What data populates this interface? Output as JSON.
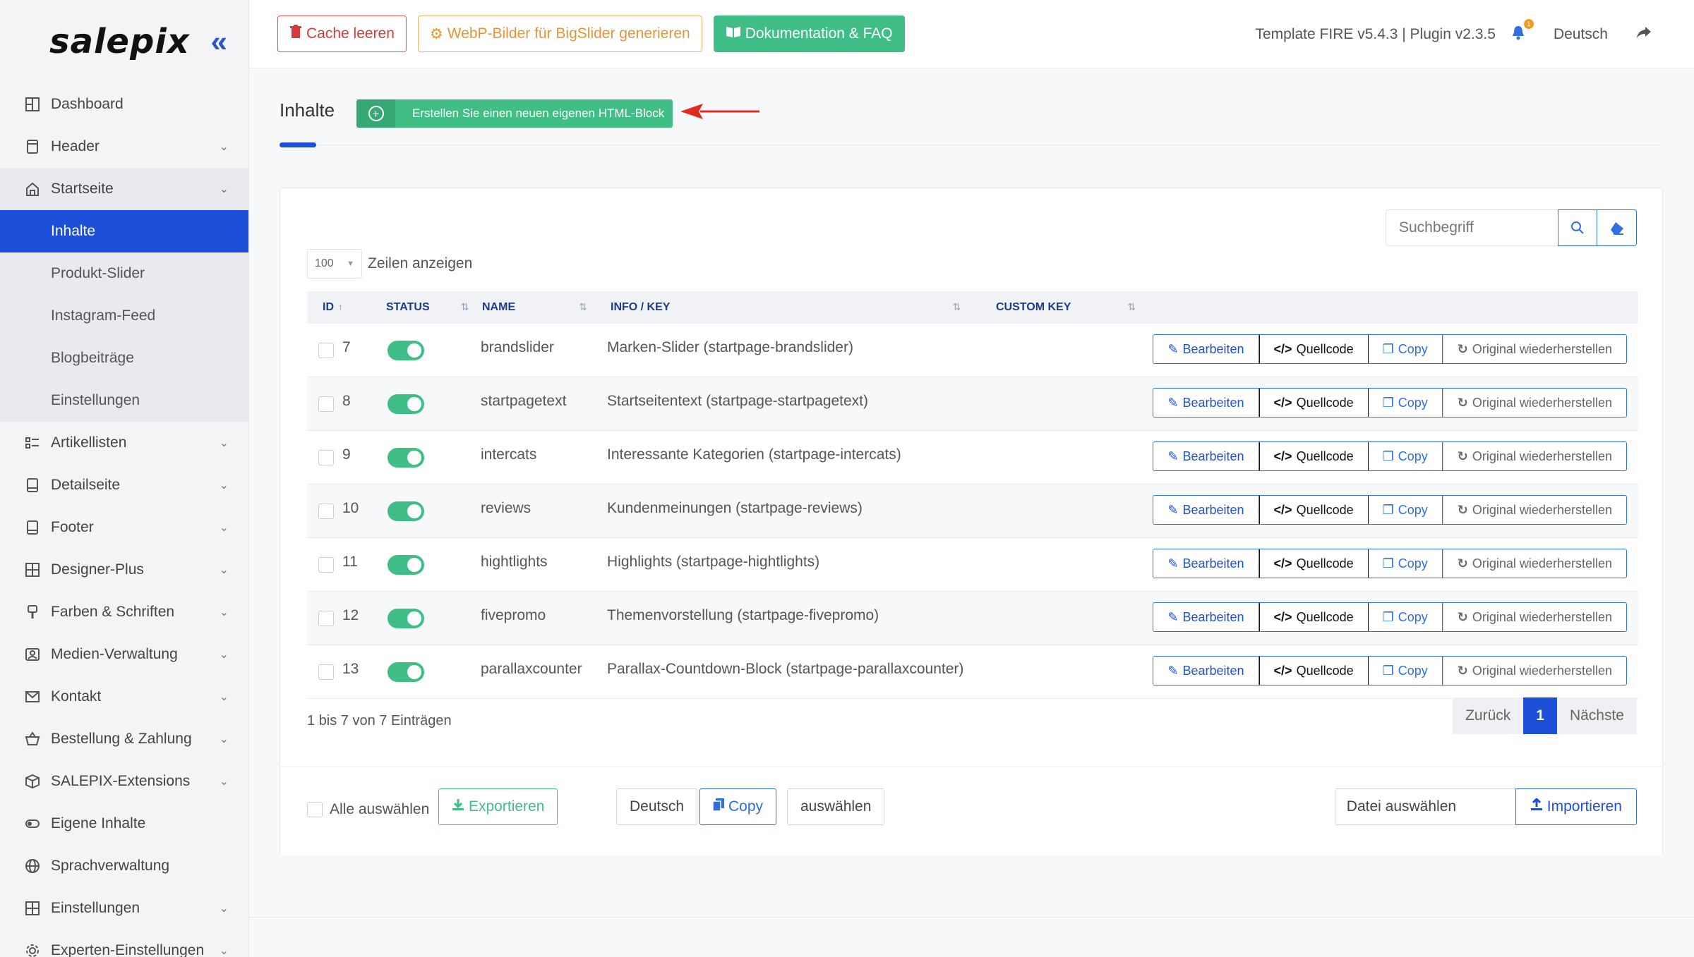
{
  "sidebar": {
    "logo": "salepix",
    "items": [
      {
        "label": "Dashboard",
        "icon": "dashboard-icon"
      },
      {
        "label": "Header",
        "icon": "header-icon"
      },
      {
        "label": "Startseite",
        "icon": "home-icon"
      },
      {
        "label": "Artikellisten",
        "icon": "list-icon"
      },
      {
        "label": "Detailseite",
        "icon": "page-icon"
      },
      {
        "label": "Footer",
        "icon": "page-icon"
      },
      {
        "label": "Designer-Plus",
        "icon": "grid-icon"
      },
      {
        "label": "Farben & Schriften",
        "icon": "paint-icon"
      },
      {
        "label": "Medien-Verwaltung",
        "icon": "image-icon"
      },
      {
        "label": "Kontakt",
        "icon": "mail-icon"
      },
      {
        "label": "Bestellung & Zahlung",
        "icon": "basket-icon"
      },
      {
        "label": "SALEPIX-Extensions",
        "icon": "cube-icon"
      },
      {
        "label": "Eigene Inhalte",
        "icon": "toggle-icon"
      },
      {
        "label": "Sprachverwaltung",
        "icon": "globe-icon"
      },
      {
        "label": "Einstellungen",
        "icon": "grid-icon"
      },
      {
        "label": "Experten-Einstellungen",
        "icon": "gear-icon"
      }
    ],
    "sub_items": [
      "Inhalte",
      "Produkt-Slider",
      "Instagram-Feed",
      "Blogbeiträge",
      "Einstellungen"
    ]
  },
  "topbar": {
    "cache_label": "Cache leeren",
    "webp_label": "WebP-Bilder für BigSlider generieren",
    "doc_label": "Dokumentation & FAQ",
    "version": "Template FIRE v5.4.3 | Plugin v2.3.5",
    "notifications": "1",
    "language": "Deutsch"
  },
  "page": {
    "title": "Inhalte",
    "create_label": "Erstellen Sie einen neuen eigenen HTML-Block"
  },
  "table": {
    "search_placeholder": "Suchbegriff",
    "page_length": "100",
    "length_label": "Zeilen anzeigen",
    "columns": [
      "ID",
      "STATUS",
      "NAME",
      "INFO / KEY",
      "CUSTOM KEY"
    ],
    "rows": [
      {
        "id": "7",
        "name": "brandslider",
        "info": "Marken-Slider (startpage-brandslider)",
        "enabled": true
      },
      {
        "id": "8",
        "name": "startpagetext",
        "info": "Startseitentext (startpage-startpagetext)",
        "enabled": true
      },
      {
        "id": "9",
        "name": "intercats",
        "info": "Interessante Kategorien (startpage-intercats)",
        "enabled": true
      },
      {
        "id": "10",
        "name": "reviews",
        "info": "Kundenmeinungen (startpage-reviews)",
        "enabled": true
      },
      {
        "id": "11",
        "name": "hightlights",
        "info": "Highlights (startpage-hightlights)",
        "enabled": true
      },
      {
        "id": "12",
        "name": "fivepromo",
        "info": "Themenvorstellung (startpage-fivepromo)",
        "enabled": true
      },
      {
        "id": "13",
        "name": "parallaxcounter",
        "info": "Parallax-Countdown-Block (startpage-parallaxcounter)",
        "enabled": true
      }
    ],
    "actions": {
      "edit": "Bearbeiten",
      "source": "Quellcode",
      "copy": "Copy",
      "reset": "Original wiederherstellen"
    },
    "info": "1 bis 7 von 7 Einträgen",
    "pager": {
      "prev": "Zurück",
      "current": "1",
      "next": "Nächste"
    }
  },
  "footer_bar": {
    "select_all": "Alle auswählen",
    "export": "Exportieren",
    "language": "Deutsch",
    "copy": "Copy",
    "choose": "auswählen",
    "file": "Datei auswählen",
    "import": "Importieren"
  },
  "colors": {
    "accent": "#1e4fd8",
    "success": "#3fbf87",
    "danger": "#d63b3b",
    "warning": "#e59537"
  }
}
